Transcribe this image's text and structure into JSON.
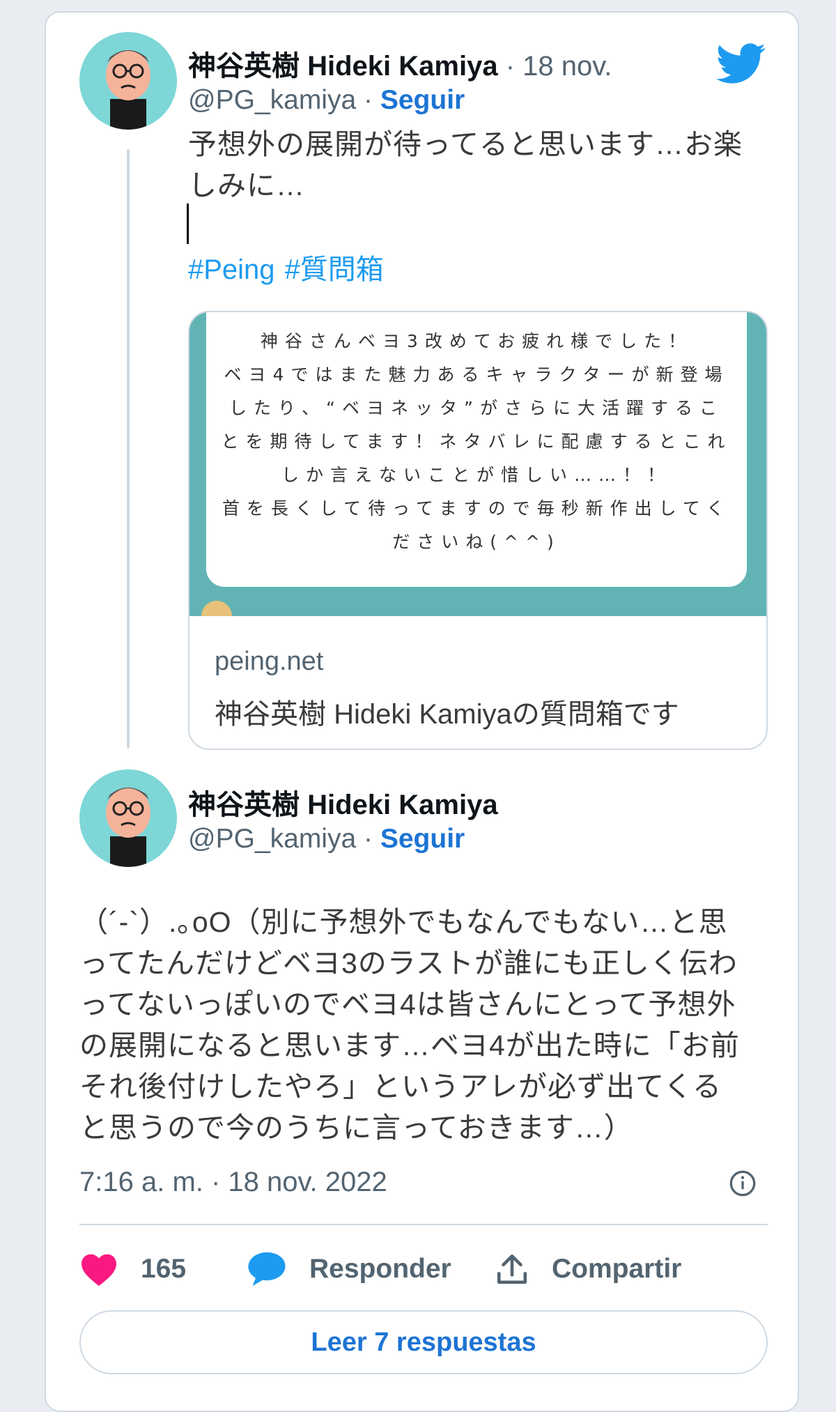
{
  "colors": {
    "accent": "#1d74d4",
    "hashtag": "#1d9bf0",
    "like": "#f91880",
    "reply": "#1d9bf0",
    "border": "#cfd9e2",
    "peing_teal": "#62b4b4"
  },
  "tweet1": {
    "name": "神谷英樹 Hideki Kamiya",
    "date": "· 18 nov.",
    "handle": "@PG_kamiya",
    "separator": "·",
    "follow": "Seguir",
    "text": "予想外の展開が待ってると思います…お楽\nしみに…",
    "hashtags": [
      "#Peing",
      "#質問箱"
    ],
    "link_card": {
      "image_text": "神谷さんベヨ3改めてお疲れ様でした！\nベヨ4ではまた魅力あるキャラクターが新登場\nしたり、“ベヨネッタ”がさらに大活躍するこ\nとを期待してます！ネタバレに配慮するとこれ\nしか言えないことが惜しい……！！\n首を長くして待ってますので毎秒新作出してく\nださいね(^^)",
      "domain": "peing.net",
      "title": "神谷英樹 Hideki Kamiyaの質問箱です"
    }
  },
  "tweet2": {
    "name": "神谷英樹 Hideki Kamiya",
    "handle": "@PG_kamiya",
    "separator": "·",
    "follow": "Seguir",
    "text": "（´-`）.｡oO（別に予想外でもなんでもない…と思\nってたんだけどベヨ3のラストが誰にも正しく伝わ\nってないっぽいのでベヨ4は皆さんにとって予想外\nの展開になると思います…ベヨ4が出た時に「お前\nそれ後付けしたやろ」というアレが必ず出てくる\nと思うので今のうちに言っておきます…）",
    "timestamp": "7:16 a. m. · 18 nov. 2022"
  },
  "actions": {
    "likes": "165",
    "reply_label": "Responder",
    "share_label": "Compartir"
  },
  "read_replies_label": "Leer 7 respuestas",
  "icons": {
    "logo": "twitter-bird-icon",
    "info": "info-icon",
    "like": "heart-icon",
    "reply": "speech-bubble-icon",
    "share": "share-upload-icon"
  }
}
